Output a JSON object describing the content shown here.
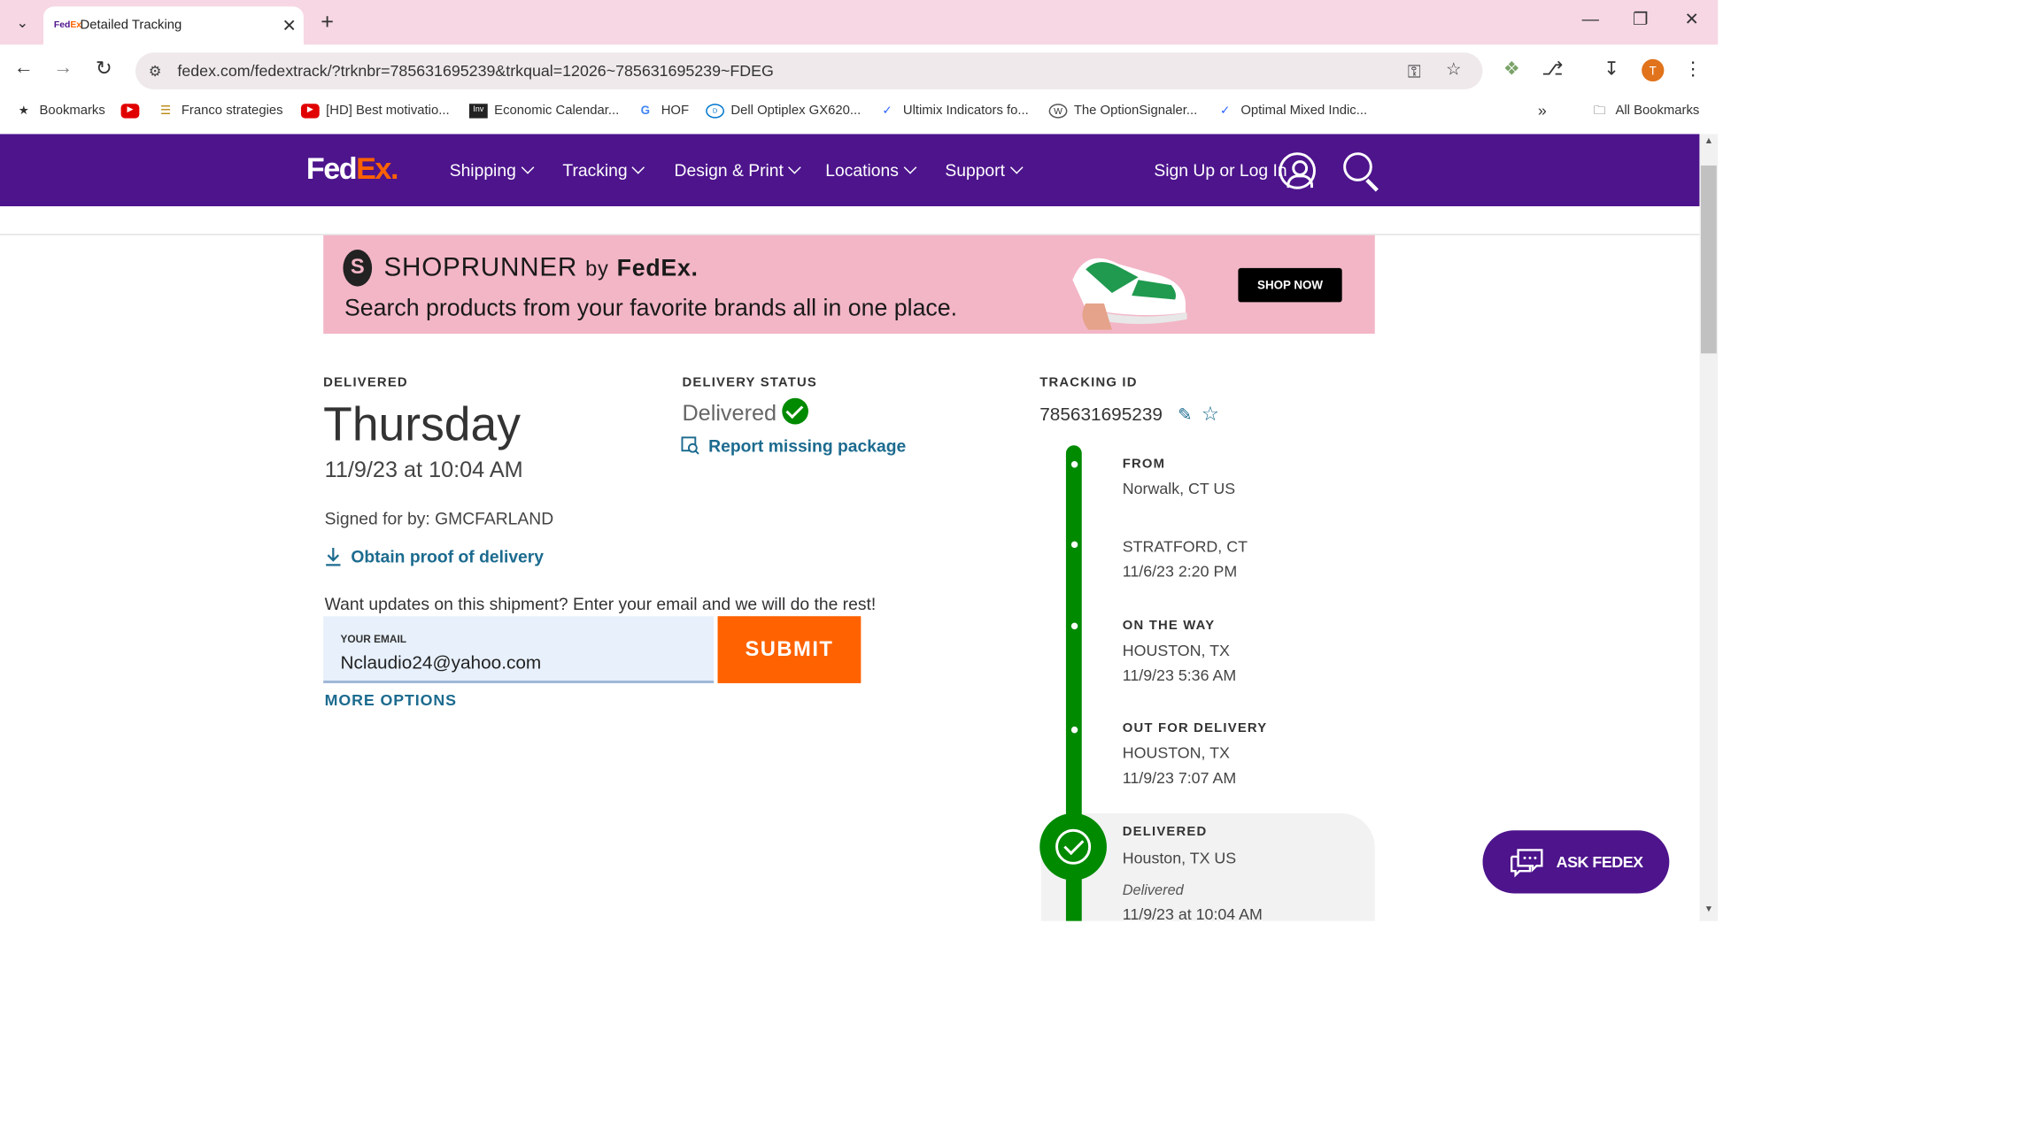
{
  "browser": {
    "tab_title": "Detailed Tracking",
    "tab_favicon": "FedEx",
    "url": "fedex.com/fedextrack/?trknbr=785631695239&trkqual=12026~785631695239~FDEG",
    "profile_initial": "T",
    "bookmarks": [
      {
        "label": "Bookmarks",
        "icon": "star-icon"
      },
      {
        "label": "",
        "icon": "youtube-icon"
      },
      {
        "label": "Franco strategies",
        "icon": "layers-icon"
      },
      {
        "label": "[HD] Best motivatio...",
        "icon": "youtube-icon"
      },
      {
        "label": "Economic Calendar...",
        "icon": "investing-icon"
      },
      {
        "label": "HOF",
        "icon": "google-icon"
      },
      {
        "label": "Dell Optiplex GX620...",
        "icon": "dell-icon"
      },
      {
        "label": "Ultimix Indicators fo...",
        "icon": "tradingview-icon"
      },
      {
        "label": "The OptionSignaler...",
        "icon": "wordpress-icon"
      },
      {
        "label": "Optimal Mixed Indic...",
        "icon": "tradingview-icon"
      }
    ],
    "overflow": "»",
    "all_bookmarks": "All Bookmarks"
  },
  "fedex_nav": {
    "logo_fed": "Fed",
    "logo_ex": "Ex",
    "logo_dot": ".",
    "menu": [
      "Shipping",
      "Tracking",
      "Design & Print",
      "Locations",
      "Support"
    ],
    "signin": "Sign Up or Log In"
  },
  "banner": {
    "brand": "SHOPRUNNER",
    "by": "by",
    "brand_partner": "FedEx.",
    "tagline": "Search products from your favorite brands all in one place.",
    "cta": "SHOP NOW"
  },
  "delivery": {
    "label": "DELIVERED",
    "day": "Thursday",
    "date": "11/9/23 at 10:04 AM",
    "signed": "Signed for by: GMCFARLAND",
    "proof_link": "Obtain proof of delivery",
    "updates_text": "Want updates on this shipment? Enter your email and we will do the rest!",
    "email_label": "YOUR EMAIL",
    "email_value": "Nclaudio24@yahoo.com",
    "submit": "SUBMIT",
    "more_options": "MORE OPTIONS"
  },
  "status": {
    "label": "DELIVERY STATUS",
    "value": "Delivered",
    "report_link": "Report missing package"
  },
  "tracking": {
    "label": "TRACKING ID",
    "id": "785631695239",
    "events": [
      {
        "title": "FROM",
        "location": "Norwalk, CT US",
        "time": ""
      },
      {
        "title": "",
        "location": "STRATFORD, CT",
        "time": "11/6/23 2:20 PM"
      },
      {
        "title": "ON THE WAY",
        "location": "HOUSTON, TX",
        "time": "11/9/23 5:36 AM"
      },
      {
        "title": "OUT FOR DELIVERY",
        "location": "HOUSTON, TX",
        "time": "11/9/23 7:07 AM"
      },
      {
        "title": "DELIVERED",
        "location": "Houston, TX US",
        "note": "Delivered",
        "time": "11/9/23 at 10:04 AM"
      }
    ]
  },
  "chat": {
    "label": "ASK FEDEX"
  },
  "colors": {
    "fedex_purple": "#4d148c",
    "fedex_orange": "#ff6200",
    "success_green": "#008a00",
    "link_blue": "#1c6b8f"
  }
}
